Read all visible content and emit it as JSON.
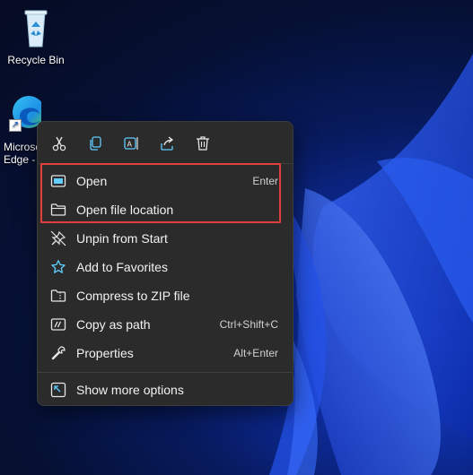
{
  "desktop": {
    "icons": [
      {
        "label": "Recycle Bin"
      },
      {
        "label_line1": "Microsoft",
        "label_line2": "Edge -"
      }
    ]
  },
  "context_menu": {
    "toolbar": [
      {
        "icon": "cut-icon"
      },
      {
        "icon": "copy-icon"
      },
      {
        "icon": "rename-icon"
      },
      {
        "icon": "share-icon"
      },
      {
        "icon": "delete-icon"
      }
    ],
    "items": [
      {
        "label": "Open",
        "shortcut": "Enter",
        "icon": "open-window-icon"
      },
      {
        "label": "Open file location",
        "shortcut": "",
        "icon": "folder-icon"
      },
      {
        "label": "Unpin from Start",
        "shortcut": "",
        "icon": "unpin-icon"
      },
      {
        "label": "Add to Favorites",
        "shortcut": "",
        "icon": "star-icon"
      },
      {
        "label": "Compress to ZIP file",
        "shortcut": "",
        "icon": "zip-folder-icon"
      },
      {
        "label": "Copy as path",
        "shortcut": "Ctrl+Shift+C",
        "icon": "copy-path-icon"
      },
      {
        "label": "Properties",
        "shortcut": "Alt+Enter",
        "icon": "wrench-icon"
      },
      {
        "label": "Show more options",
        "shortcut": "",
        "icon": "more-options-icon"
      }
    ]
  },
  "colors": {
    "menu_bg": "#2b2b2b",
    "highlight_border": "#e0403c",
    "accent_blue": "#60cdff"
  }
}
